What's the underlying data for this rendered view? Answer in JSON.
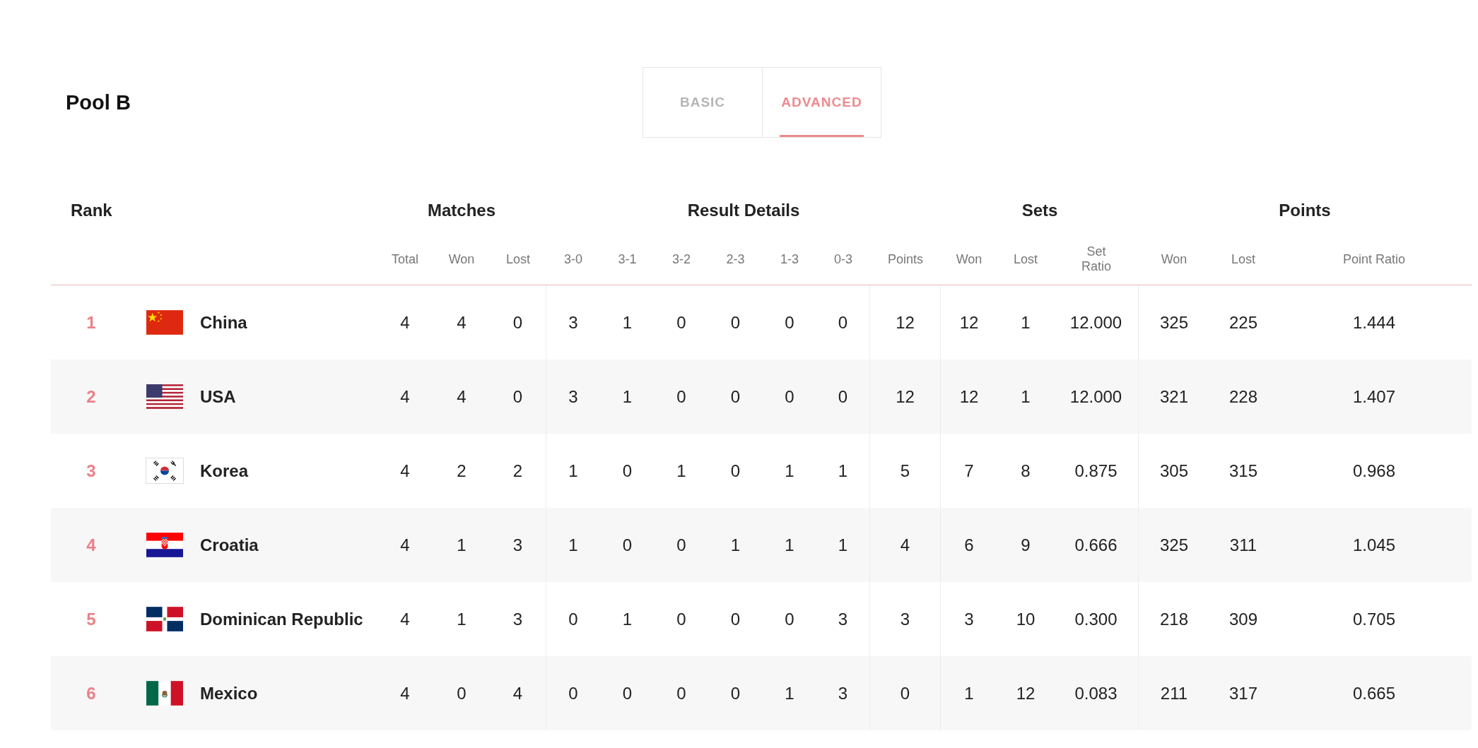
{
  "title": "Pool B",
  "tabs": [
    {
      "label": "BASIC",
      "selected": false
    },
    {
      "label": "ADVANCED",
      "selected": true
    }
  ],
  "groups": [
    "Rank",
    "Matches",
    "Result Details",
    "Sets",
    "Points"
  ],
  "columns": [
    "Total",
    "Won",
    "Lost",
    "3-0",
    "3-1",
    "3-2",
    "2-3",
    "1-3",
    "0-3",
    "Points",
    "Won",
    "Lost",
    "Set Ratio",
    "Won",
    "Lost",
    "Point Ratio"
  ],
  "rows": [
    {
      "rank": "1",
      "kind": "china",
      "country": "China",
      "values": [
        "4",
        "4",
        "0",
        "3",
        "1",
        "0",
        "0",
        "0",
        "0",
        "12",
        "12",
        "1",
        "12.000",
        "325",
        "225",
        "1.444"
      ]
    },
    {
      "rank": "2",
      "kind": "usa",
      "country": "USA",
      "values": [
        "4",
        "4",
        "0",
        "3",
        "1",
        "0",
        "0",
        "0",
        "0",
        "12",
        "12",
        "1",
        "12.000",
        "321",
        "228",
        "1.407"
      ]
    },
    {
      "rank": "3",
      "kind": "korea",
      "country": "Korea",
      "values": [
        "4",
        "2",
        "2",
        "1",
        "0",
        "1",
        "0",
        "1",
        "1",
        "5",
        "7",
        "8",
        "0.875",
        "305",
        "315",
        "0.968"
      ]
    },
    {
      "rank": "4",
      "kind": "croatia",
      "country": "Croatia",
      "values": [
        "4",
        "1",
        "3",
        "1",
        "0",
        "0",
        "1",
        "1",
        "1",
        "4",
        "6",
        "9",
        "0.666",
        "325",
        "311",
        "1.045"
      ]
    },
    {
      "rank": "5",
      "kind": "dominican",
      "country": "Dominican Republic",
      "values": [
        "4",
        "1",
        "3",
        "0",
        "1",
        "0",
        "0",
        "0",
        "3",
        "3",
        "3",
        "10",
        "0.300",
        "218",
        "309",
        "0.705"
      ]
    },
    {
      "rank": "6",
      "kind": "mexico",
      "country": "Mexico",
      "values": [
        "4",
        "0",
        "4",
        "0",
        "0",
        "0",
        "0",
        "1",
        "3",
        "0",
        "1",
        "12",
        "0.083",
        "211",
        "317",
        "0.665"
      ]
    }
  ]
}
